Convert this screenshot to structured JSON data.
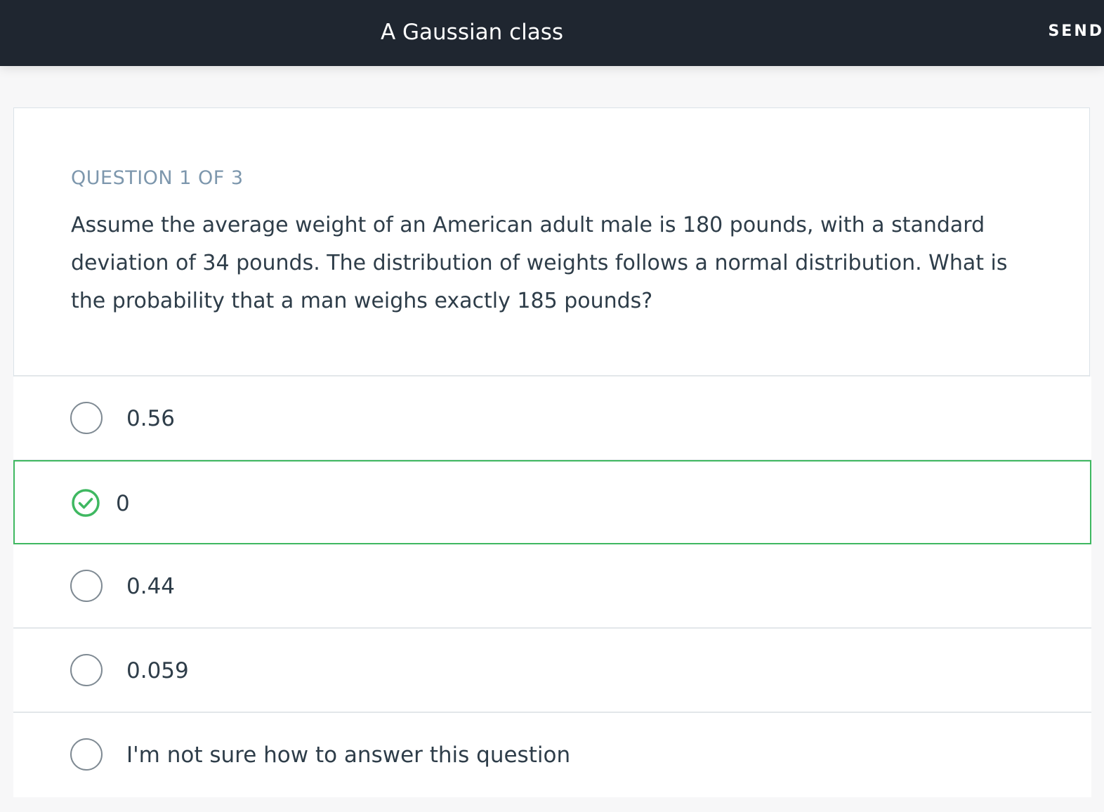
{
  "header": {
    "title": "A Gaussian class",
    "send_label": "SEND"
  },
  "quiz": {
    "counter": "QUESTION 1 OF 3",
    "question": "Assume the average weight of an American adult male is 180 pounds, with a standard deviation of 34 pounds. The distribution of weights follows a normal distribution. What is the probability that a man weighs exactly 185 pounds?",
    "options": [
      {
        "label": "0.56",
        "selected": false
      },
      {
        "label": "0",
        "selected": true
      },
      {
        "label": "0.44",
        "selected": false
      },
      {
        "label": "0.059",
        "selected": false
      },
      {
        "label": "I'm not sure how to answer this question",
        "selected": false
      }
    ]
  },
  "colors": {
    "header_bg": "#1f2630",
    "selected_accent": "#3fb861",
    "counter_text": "#7d97ad"
  }
}
